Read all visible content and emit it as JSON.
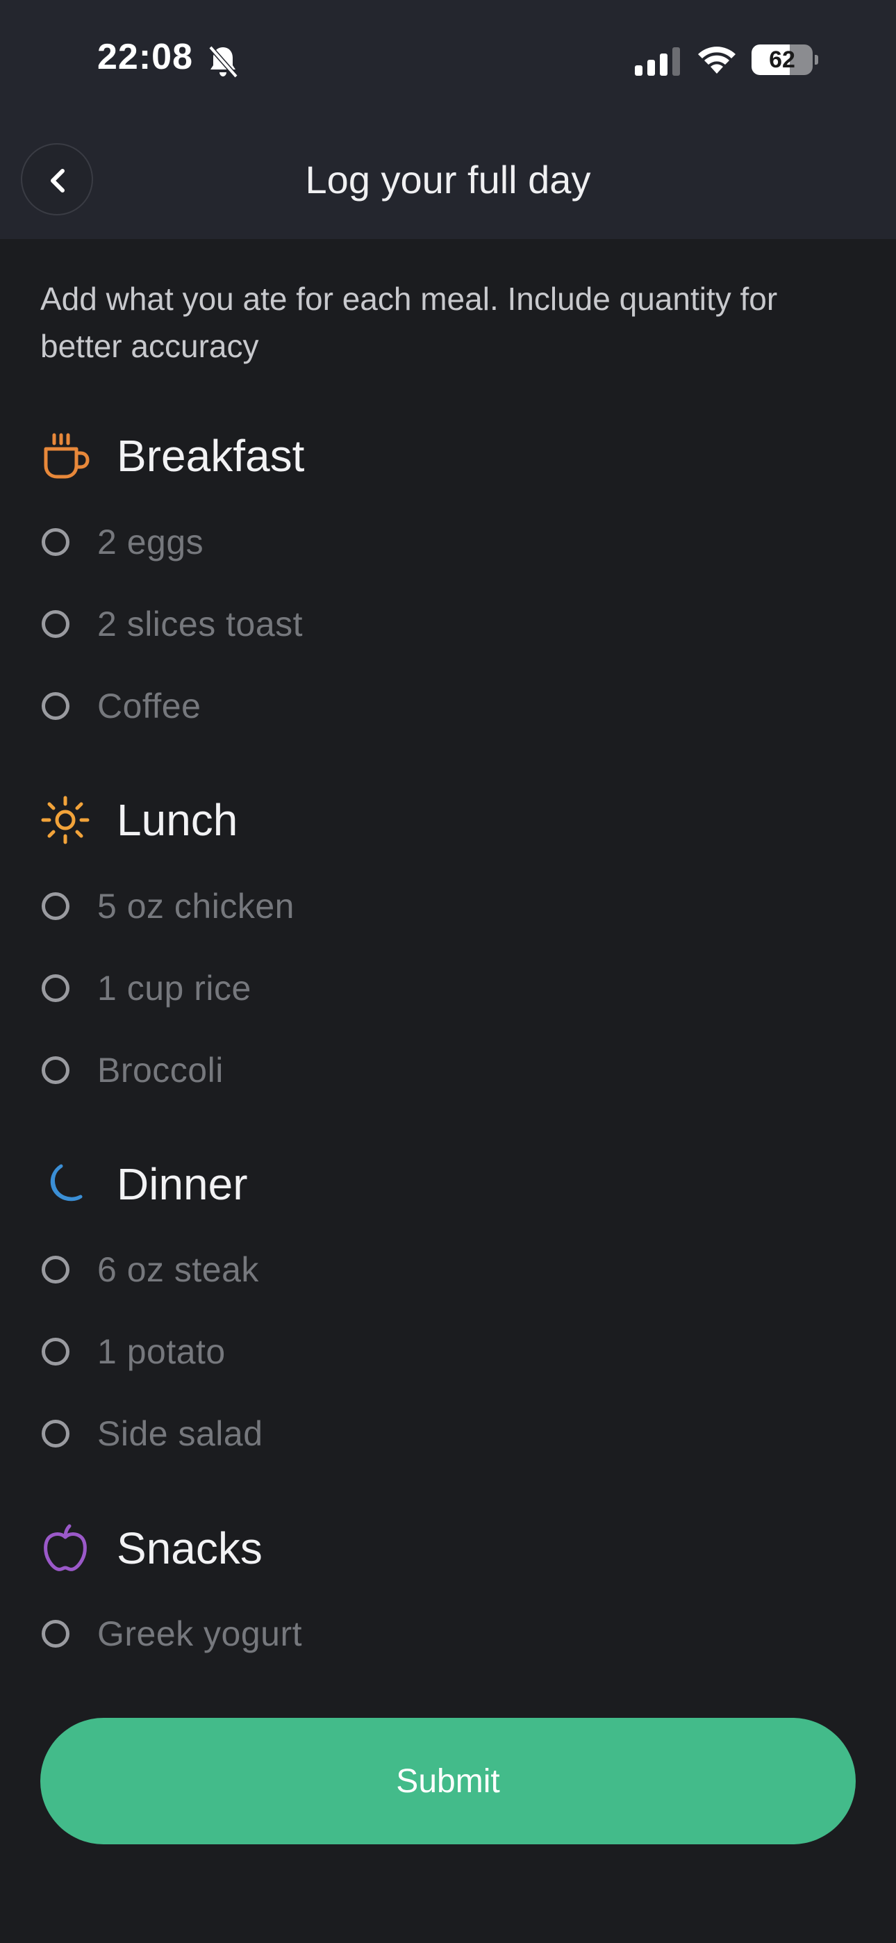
{
  "status_bar": {
    "time": "22:08",
    "battery": "62",
    "battery_level": 0.62,
    "icons": [
      "bell-slash-icon",
      "cellular-signal-icon",
      "wifi-icon",
      "battery-icon"
    ]
  },
  "nav": {
    "back_icon": "chevron-left-icon",
    "title": "Log your full day"
  },
  "intro": "Add what you ate for each meal. Include quantity for better accuracy",
  "colors": {
    "background": "#1b1c1f",
    "header": "#24262e",
    "breakfast_icon": "#e8883a",
    "lunch_icon": "#f2a33a",
    "dinner_icon": "#3b8fd6",
    "snacks_icon": "#9b59c9",
    "submit": "#43bb8a"
  },
  "meals": [
    {
      "title": "Breakfast",
      "icon": "coffee-cup-icon",
      "items": [
        "2 eggs",
        "2 slices toast",
        "Coffee"
      ]
    },
    {
      "title": "Lunch",
      "icon": "sun-icon",
      "items": [
        "5 oz chicken",
        "1 cup rice",
        "Broccoli"
      ]
    },
    {
      "title": "Dinner",
      "icon": "moon-icon",
      "items": [
        "6 oz steak",
        "1 potato",
        "Side salad"
      ]
    },
    {
      "title": "Snacks",
      "icon": "apple-icon",
      "items": [
        "Greek yogurt"
      ]
    }
  ],
  "submit_label": "Submit"
}
